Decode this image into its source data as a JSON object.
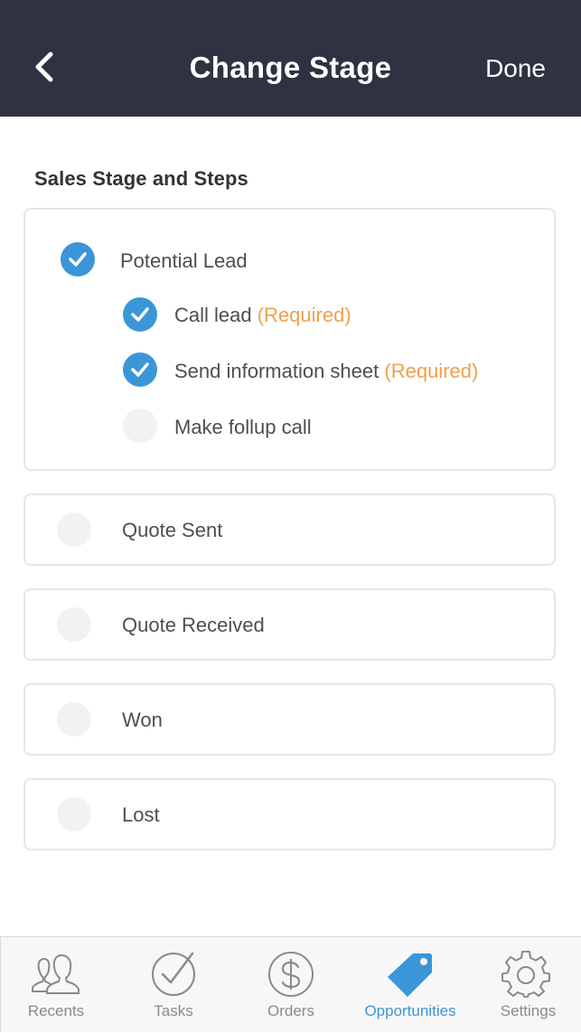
{
  "header": {
    "title": "Change Stage",
    "done_label": "Done"
  },
  "section_title": "Sales Stage and Steps",
  "stages": [
    {
      "label": "Potential Lead",
      "checked": true,
      "steps": [
        {
          "label": "Call lead",
          "required": "(Required)",
          "checked": true
        },
        {
          "label": "Send information sheet",
          "required": "(Required)",
          "checked": true
        },
        {
          "label": "Make follup call",
          "required": "",
          "checked": false
        }
      ]
    },
    {
      "label": "Quote Sent",
      "checked": false
    },
    {
      "label": "Quote Received",
      "checked": false
    },
    {
      "label": "Won",
      "checked": false
    },
    {
      "label": "Lost",
      "checked": false
    }
  ],
  "tabbar": {
    "items": [
      {
        "label": "Recents",
        "icon": "people-icon",
        "active": false
      },
      {
        "label": "Tasks",
        "icon": "check-circle-icon",
        "active": false
      },
      {
        "label": "Orders",
        "icon": "dollar-circle-icon",
        "active": false
      },
      {
        "label": "Opportunities",
        "icon": "tag-icon",
        "active": true
      },
      {
        "label": "Settings",
        "icon": "gear-icon",
        "active": false
      }
    ]
  },
  "colors": {
    "header_bg": "#2f3341",
    "accent": "#3b96d8",
    "required": "#f0a04b",
    "unchecked": "#f2f2f2"
  }
}
